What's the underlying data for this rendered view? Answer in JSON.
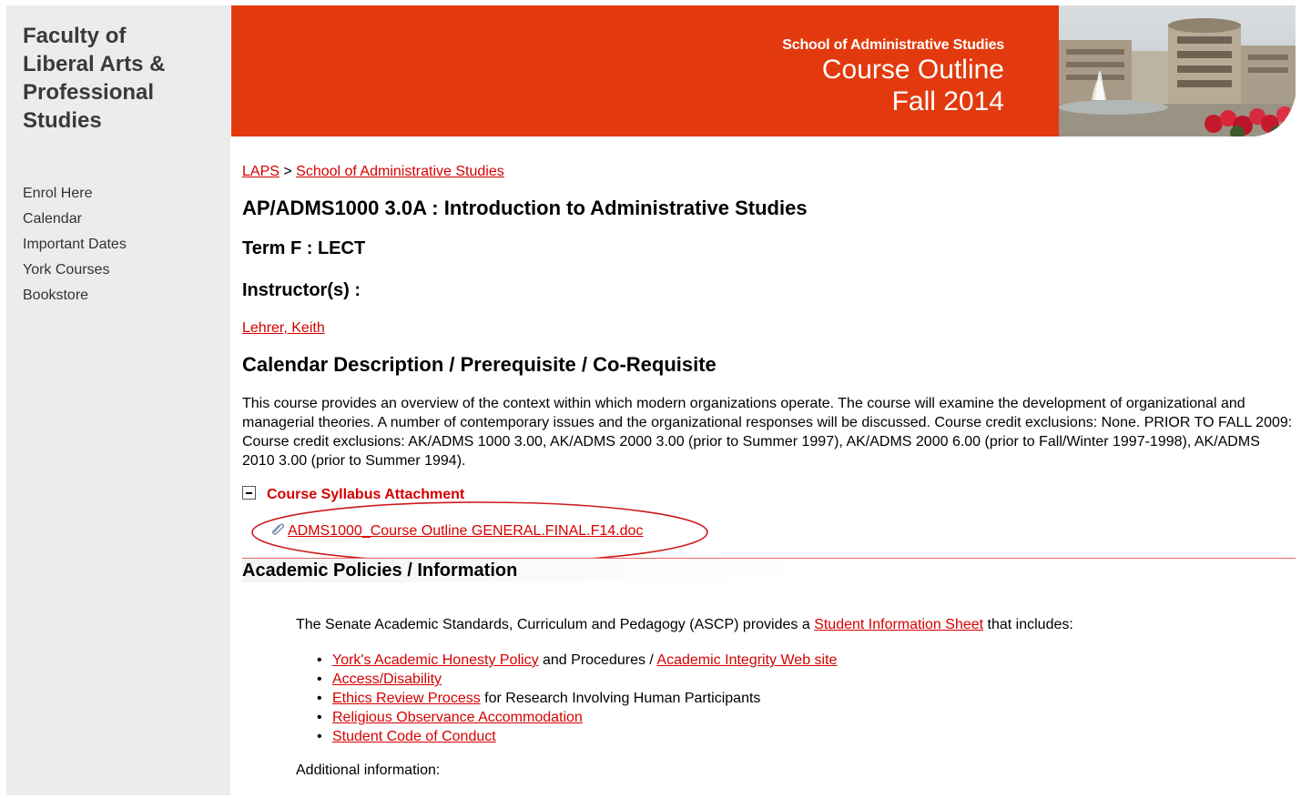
{
  "sidebar": {
    "faculty_line1": "Faculty of",
    "faculty_line2": "Liberal Arts &",
    "faculty_line3": "Professional",
    "faculty_line4": "Studies",
    "nav": [
      "Enrol Here",
      "Calendar",
      "Important Dates",
      "York Courses",
      "Bookstore"
    ]
  },
  "header": {
    "school": "School of Administrative Studies",
    "title": "Course Outline",
    "term": "Fall 2014",
    "color": "#e23a0e"
  },
  "breadcrumb": {
    "home": "LAPS",
    "sep": " > ",
    "school": "School of Administrative Studies"
  },
  "course": {
    "title": "AP/ADMS1000 3.0A : Introduction to Administrative Studies",
    "term": "Term F : LECT",
    "instructors_label": "Instructor(s) :",
    "instructor": "Lehrer, Keith",
    "description_heading": "Calendar Description / Prerequisite / Co-Requisite",
    "description": "This course provides an overview of the context within which modern organizations operate. The course will examine the development of organizational and managerial theories. A number of contemporary issues and the organizational responses will be discussed. Course credit exclusions: None. PRIOR TO FALL 2009: Course credit exclusions: AK/ADMS 1000 3.00, AK/ADMS 2000 3.00 (prior to Summer 1997), AK/ADMS 2000 6.00 (prior to Fall/Winter 1997-1998), AK/ADMS 2010 3.00 (prior to Summer 1994)."
  },
  "syllabus": {
    "heading": "Course Syllabus Attachment",
    "file": "ADMS1000_Course Outline GENERAL.FINAL.F14.doc",
    "icon": "paperclip-icon"
  },
  "academic": {
    "heading": "Academic Policies / Information",
    "intro_before": "The Senate Academic Standards, Curriculum and Pedagogy (ASCP) provides a ",
    "intro_link": "Student Information Sheet",
    "intro_after": " that includes:",
    "item1_link": "York's Academic Honesty Policy",
    "item1_mid": " and Procedures / ",
    "item1_link2": "Academic Integrity Web site",
    "item2_link": "Access/Disability",
    "item3_link": "Ethics Review Process",
    "item3_after": " for Research Involving Human Participants",
    "item4_link": "Religious Observance Accommodation",
    "item5_link": "Student Code of Conduct",
    "additional": "Additional information:"
  },
  "colors": {
    "link": "#d60000",
    "sidebar_bg": "#ececec"
  }
}
